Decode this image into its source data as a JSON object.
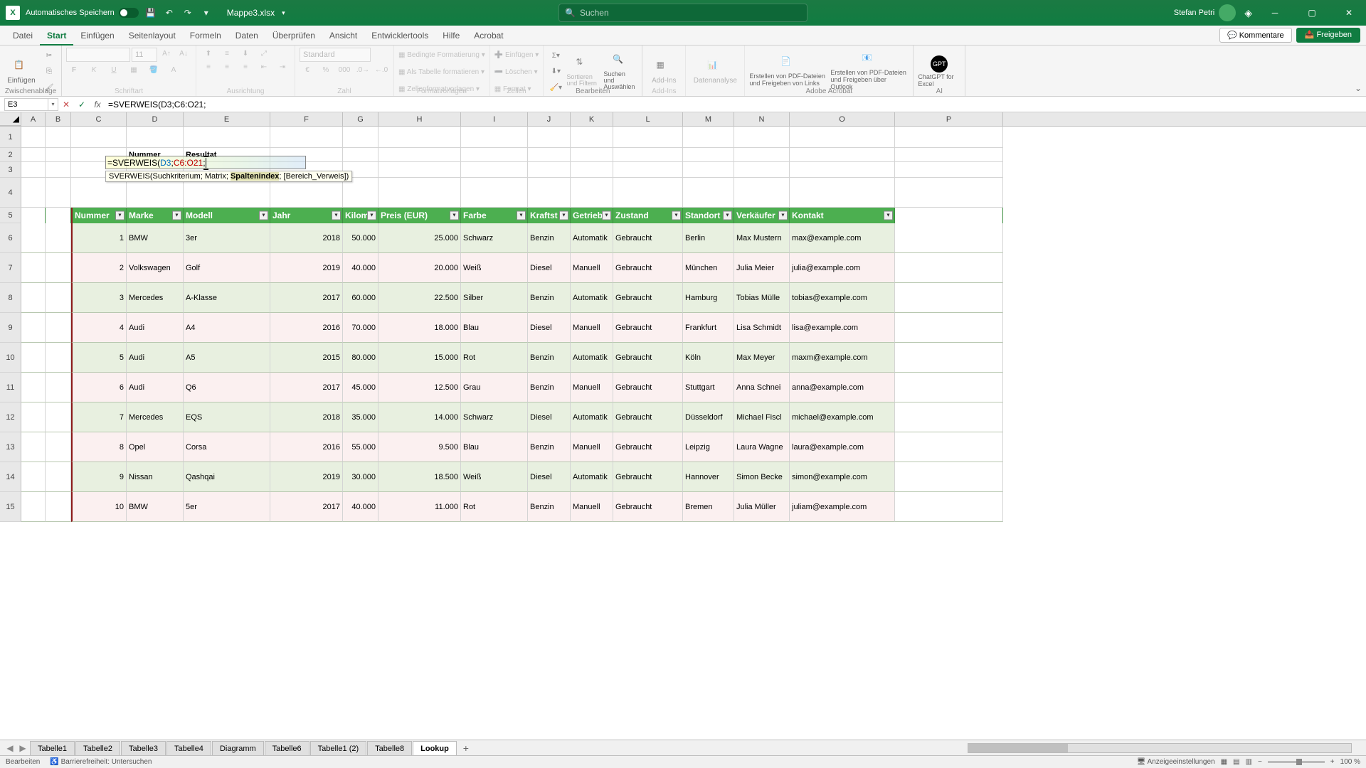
{
  "titlebar": {
    "autosave_label": "Automatisches Speichern",
    "filename": "Mappe3.xlsx",
    "search_placeholder": "Suchen",
    "username": "Stefan Petri"
  },
  "ribbon_tabs": {
    "items": [
      "Datei",
      "Start",
      "Einfügen",
      "Seitenlayout",
      "Formeln",
      "Daten",
      "Überprüfen",
      "Ansicht",
      "Entwicklertools",
      "Hilfe",
      "Acrobat"
    ],
    "active_index": 1,
    "comments": "Kommentare",
    "share": "Freigeben"
  },
  "ribbon": {
    "paste": "Einfügen",
    "clipboard": "Zwischenablage",
    "font_placeholder": "",
    "fontsize_placeholder": "11",
    "font_group": "Schriftart",
    "align_group": "Ausrichtung",
    "number_format": "Standard",
    "number_group": "Zahl",
    "cond_fmt": "Bedingte Formatierung",
    "as_table": "Als Tabelle formatieren",
    "cell_styles": "Zellenformatvorlagen",
    "styles_group": "Formatvorlagen",
    "insert": "Einfügen",
    "delete": "Löschen",
    "format": "Format",
    "cells_group": "Zellen",
    "sort_filter": "Sortieren und Filtern",
    "find_select": "Suchen und Auswählen",
    "edit_group": "Bearbeiten",
    "addins": "Add-Ins",
    "addins_group": "Add-Ins",
    "data_analysis": "Datenanalyse",
    "pdf_create": "Erstellen von PDF-Dateien und Freigeben von Links",
    "pdf_outlook": "Erstellen von PDF-Dateien und Freigeben über Outlook",
    "adobe_group": "Adobe Acrobat",
    "chatgpt": "ChatGPT for Excel",
    "ai_group": "AI"
  },
  "formula_bar": {
    "namebox": "E3",
    "formula": "=SVERWEIS(D3;C6:O21;"
  },
  "columns": [
    "A",
    "B",
    "C",
    "D",
    "E",
    "F",
    "G",
    "H",
    "I",
    "J",
    "K",
    "L",
    "M",
    "N",
    "O",
    "P"
  ],
  "rows_visible": [
    1,
    2,
    3,
    4,
    5,
    6,
    7,
    8,
    9,
    10,
    11,
    12,
    13,
    14,
    15
  ],
  "row_heights": {
    "1": 30,
    "2": 20,
    "3": 22,
    "4": 42,
    "5": 22
  },
  "lookup_header": {
    "nummer": "Nummer",
    "resultat": "Resultat"
  },
  "edit_cell": {
    "text": "=SVERWEIS(D3;C6:O21;",
    "tooltip_full": "SVERWEIS(Suchkriterium; Matrix; Spaltenindex; [Bereich_Verweis])",
    "tooltip_before": "SVERWEIS(Suchkriterium; Matrix; ",
    "tooltip_active": "Spaltenindex",
    "tooltip_after": "; [Bereich_Verweis])"
  },
  "table": {
    "headers": [
      "Nummer",
      "Marke",
      "Modell",
      "Jahr",
      "Kilom",
      "Preis (EUR)",
      "Farbe",
      "Kraftst",
      "Getriebe",
      "Zustand",
      "Standort",
      "Verkäufer",
      "Kontakt"
    ],
    "rows": [
      {
        "n": "1",
        "marke": "BMW",
        "modell": "3er",
        "jahr": "2018",
        "km": "50.000",
        "preis": "25.000",
        "farbe": "Schwarz",
        "kraft": "Benzin",
        "getr": "Automatik",
        "zust": "Gebraucht",
        "ort": "Berlin",
        "verk": "Max Mustern",
        "kontakt": "max@example.com"
      },
      {
        "n": "2",
        "marke": "Volkswagen",
        "modell": "Golf",
        "jahr": "2019",
        "km": "40.000",
        "preis": "20.000",
        "farbe": "Weiß",
        "kraft": "Diesel",
        "getr": "Manuell",
        "zust": "Gebraucht",
        "ort": "München",
        "verk": "Julia Meier",
        "kontakt": "julia@example.com"
      },
      {
        "n": "3",
        "marke": "Mercedes",
        "modell": "A-Klasse",
        "jahr": "2017",
        "km": "60.000",
        "preis": "22.500",
        "farbe": "Silber",
        "kraft": "Benzin",
        "getr": "Automatik",
        "zust": "Gebraucht",
        "ort": "Hamburg",
        "verk": "Tobias Mülle",
        "kontakt": "tobias@example.com"
      },
      {
        "n": "4",
        "marke": "Audi",
        "modell": "A4",
        "jahr": "2016",
        "km": "70.000",
        "preis": "18.000",
        "farbe": "Blau",
        "kraft": "Diesel",
        "getr": "Manuell",
        "zust": "Gebraucht",
        "ort": "Frankfurt",
        "verk": "Lisa Schmidt",
        "kontakt": "lisa@example.com"
      },
      {
        "n": "5",
        "marke": "Audi",
        "modell": "A5",
        "jahr": "2015",
        "km": "80.000",
        "preis": "15.000",
        "farbe": "Rot",
        "kraft": "Benzin",
        "getr": "Automatik",
        "zust": "Gebraucht",
        "ort": "Köln",
        "verk": "Max Meyer",
        "kontakt": "maxm@example.com"
      },
      {
        "n": "6",
        "marke": "Audi",
        "modell": "Q6",
        "jahr": "2017",
        "km": "45.000",
        "preis": "12.500",
        "farbe": "Grau",
        "kraft": "Benzin",
        "getr": "Manuell",
        "zust": "Gebraucht",
        "ort": "Stuttgart",
        "verk": "Anna Schnei",
        "kontakt": "anna@example.com"
      },
      {
        "n": "7",
        "marke": "Mercedes",
        "modell": "EQS",
        "jahr": "2018",
        "km": "35.000",
        "preis": "14.000",
        "farbe": "Schwarz",
        "kraft": "Diesel",
        "getr": "Automatik",
        "zust": "Gebraucht",
        "ort": "Düsseldorf",
        "verk": "Michael Fiscl",
        "kontakt": "michael@example.com"
      },
      {
        "n": "8",
        "marke": "Opel",
        "modell": "Corsa",
        "jahr": "2016",
        "km": "55.000",
        "preis": "9.500",
        "farbe": "Blau",
        "kraft": "Benzin",
        "getr": "Manuell",
        "zust": "Gebraucht",
        "ort": "Leipzig",
        "verk": "Laura Wagne",
        "kontakt": "laura@example.com"
      },
      {
        "n": "9",
        "marke": "Nissan",
        "modell": "Qashqai",
        "jahr": "2019",
        "km": "30.000",
        "preis": "18.500",
        "farbe": "Weiß",
        "kraft": "Diesel",
        "getr": "Automatik",
        "zust": "Gebraucht",
        "ort": "Hannover",
        "verk": "Simon Becke",
        "kontakt": "simon@example.com"
      },
      {
        "n": "10",
        "marke": "BMW",
        "modell": "5er",
        "jahr": "2017",
        "km": "40.000",
        "preis": "11.000",
        "farbe": "Rot",
        "kraft": "Benzin",
        "getr": "Manuell",
        "zust": "Gebraucht",
        "ort": "Bremen",
        "verk": "Julia Müller",
        "kontakt": "juliam@example.com"
      }
    ]
  },
  "sheets": {
    "items": [
      "Tabelle1",
      "Tabelle2",
      "Tabelle3",
      "Tabelle4",
      "Diagramm",
      "Tabelle6",
      "Tabelle1 (2)",
      "Tabelle8",
      "Lookup"
    ],
    "active_index": 8
  },
  "statusbar": {
    "mode": "Bearbeiten",
    "access": "Barrierefreiheit: Untersuchen",
    "display_settings": "Anzeigeeinstellungen",
    "zoom": "100 %"
  }
}
